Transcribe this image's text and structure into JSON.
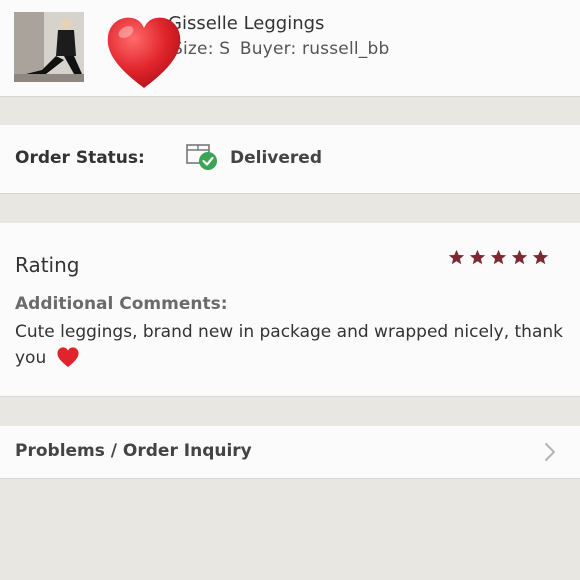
{
  "product": {
    "title": "Gisselle Leggings",
    "size_label": "Size: S",
    "buyer_label": "Buyer: russell_bb"
  },
  "order": {
    "status_label": "Order Status:",
    "status_value": "Delivered"
  },
  "rating": {
    "title": "Rating",
    "stars": 5,
    "comments_label": "Additional Comments:",
    "comments_text": "Cute leggings, brand new in package and wrapped nicely, thank you"
  },
  "problems": {
    "label": "Problems / Order Inquiry"
  },
  "colors": {
    "star": "#7b2a33",
    "heart": "#e0242b",
    "check": "#3aa655",
    "background": "#e9e7e2",
    "panel": "#fbfbfb"
  }
}
